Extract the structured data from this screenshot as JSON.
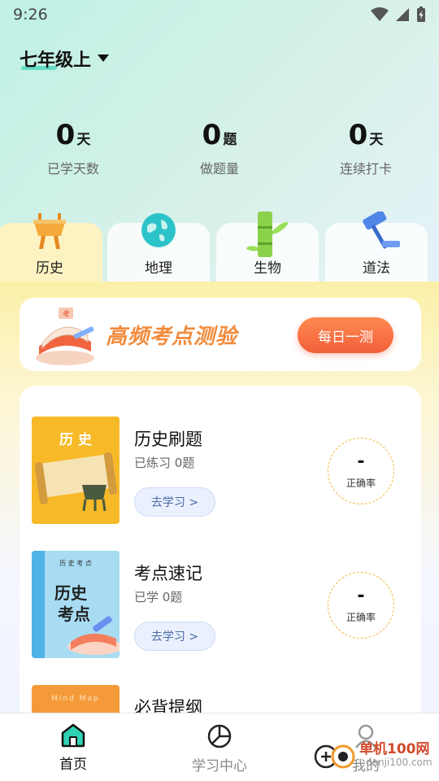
{
  "status": {
    "time": "9:26"
  },
  "grade": {
    "label": "七年级上"
  },
  "stats": [
    {
      "value": "0",
      "unit": "天",
      "label": "已学天数"
    },
    {
      "value": "0",
      "unit": "题",
      "label": "做题量"
    },
    {
      "value": "0",
      "unit": "天",
      "label": "连续打卡"
    }
  ],
  "tabs": [
    {
      "label": "历史",
      "active": true
    },
    {
      "label": "地理"
    },
    {
      "label": "生物"
    },
    {
      "label": "道法"
    }
  ],
  "banner": {
    "title": "高频考点测验",
    "button": "每日一测",
    "book_stamp": "考"
  },
  "items": [
    {
      "title": "历史刷题",
      "sub": "已练习 0题",
      "button": "去学习 >",
      "rate_value": "-",
      "rate_label": "正确率",
      "cover_text": "历 史"
    },
    {
      "title": "考点速记",
      "sub": "已学 0题",
      "button": "去学习 >",
      "rate_value": "-",
      "rate_label": "正确率",
      "cover_top": "历 史 考 点",
      "cover_line1": "历史",
      "cover_line2": "考点"
    },
    {
      "title": "必背提纲",
      "cover_top": "Mind Map"
    }
  ],
  "nav": [
    {
      "label": "首页",
      "icon": "home-icon",
      "active": true
    },
    {
      "label": "学习中心",
      "icon": "pie-chart-icon"
    },
    {
      "label": "我的",
      "icon": "user-icon"
    }
  ],
  "watermark": {
    "text": "单机100网",
    "sub": "danji100.com"
  },
  "colors": {
    "accent": "#f25f3a",
    "teal": "#39d3b6",
    "ring": "#f4b73a"
  }
}
